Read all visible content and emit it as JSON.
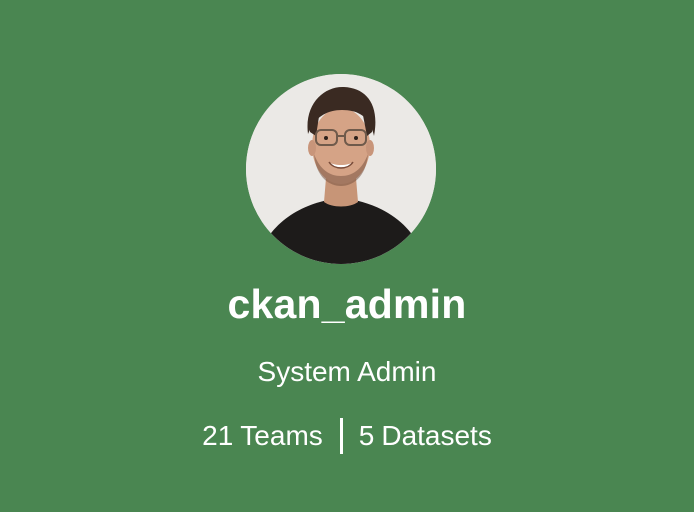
{
  "profile": {
    "username": "ckan_admin",
    "role": "System Admin",
    "stats": {
      "teams_count": "21",
      "teams_label": "Teams",
      "datasets_count": "5",
      "datasets_label": "Datasets"
    }
  },
  "colors": {
    "background": "#4a8651",
    "text": "#ffffff"
  },
  "icons": {
    "avatar": "user-avatar-photo"
  }
}
